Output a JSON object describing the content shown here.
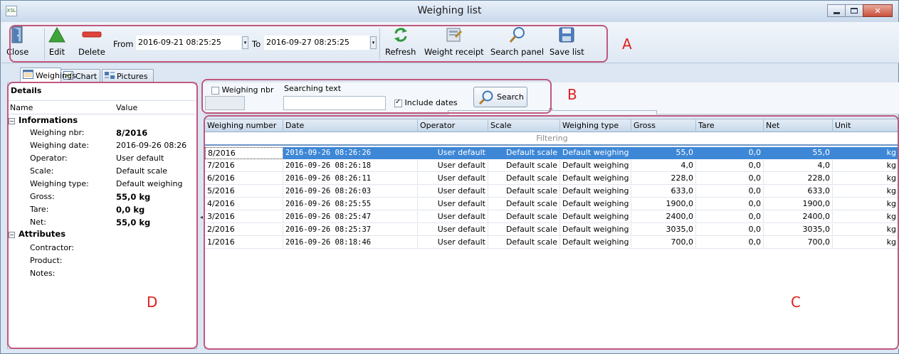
{
  "window": {
    "title": "Weighing list",
    "app_icon": "XSL"
  },
  "toolbar": {
    "close_label": "Close",
    "edit_label": "Edit",
    "delete_label": "Delete",
    "from_label": "From",
    "from_value": "2016-09-21 08:25:25",
    "to_label": "To",
    "to_value": "2016-09-27 08:25:25",
    "refresh_label": "Refresh",
    "weight_receipt_label": "Weight receipt",
    "search_panel_label": "Search panel",
    "save_list_label": "Save list"
  },
  "annotations": {
    "a": "A",
    "b": "B",
    "c": "C",
    "d": "D",
    "color": "#e02020",
    "box_color": "#c0587e"
  },
  "tabs": [
    {
      "label": "Weighings",
      "active": true
    },
    {
      "label": "Chart",
      "active": false
    },
    {
      "label": "Pictures",
      "active": false
    }
  ],
  "details": {
    "title": "Details",
    "col_name": "Name",
    "col_value": "Value",
    "group_info": "Informations",
    "group_attr": "Attributes",
    "rows": [
      {
        "name": "Weighing nbr:",
        "value": "8/2016"
      },
      {
        "name": "Weighing date:",
        "value": "2016-09-26 08:26"
      },
      {
        "name": "Operator:",
        "value": "User default"
      },
      {
        "name": "Scale:",
        "value": "Default scale"
      },
      {
        "name": "Weighing type:",
        "value": "Default weighing"
      },
      {
        "name": "Gross:",
        "value": "55,0 kg"
      },
      {
        "name": "Tare:",
        "value": "0,0 kg"
      },
      {
        "name": "Net:",
        "value": "55,0 kg"
      }
    ],
    "attributes": [
      {
        "name": "Contractor:",
        "value": ""
      },
      {
        "name": "Product:",
        "value": ""
      },
      {
        "name": "Notes:",
        "value": ""
      }
    ]
  },
  "search": {
    "weighing_nbr_label": "Weighing nbr",
    "weighing_nbr_checked": false,
    "searching_text_label": "Searching text",
    "searching_text_value": "",
    "include_dates_label": "Include dates",
    "include_dates_checked": true,
    "search_button_label": "Search"
  },
  "grid": {
    "columns": [
      "Weighing number",
      "Date",
      "Operator",
      "Scale",
      "Weighing type",
      "Gross",
      "Tare",
      "Net",
      "Unit"
    ],
    "filter_text": "Filtering",
    "selection_color": "#3d87d6",
    "rows": [
      [
        "8/2016",
        "2016-09-26 08:26:26",
        "User default",
        "Default scale",
        "Default weighing",
        "55,0",
        "0,0",
        "55,0",
        "kg"
      ],
      [
        "7/2016",
        "2016-09-26 08:26:18",
        "User default",
        "Default scale",
        "Default weighing",
        "4,0",
        "0,0",
        "4,0",
        "kg"
      ],
      [
        "6/2016",
        "2016-09-26 08:26:11",
        "User default",
        "Default scale",
        "Default weighing",
        "228,0",
        "0,0",
        "228,0",
        "kg"
      ],
      [
        "5/2016",
        "2016-09-26 08:26:03",
        "User default",
        "Default scale",
        "Default weighing",
        "633,0",
        "0,0",
        "633,0",
        "kg"
      ],
      [
        "4/2016",
        "2016-09-26 08:25:55",
        "User default",
        "Default scale",
        "Default weighing",
        "1900,0",
        "0,0",
        "1900,0",
        "kg"
      ],
      [
        "3/2016",
        "2016-09-26 08:25:47",
        "User default",
        "Default scale",
        "Default weighing",
        "2400,0",
        "0,0",
        "2400,0",
        "kg"
      ],
      [
        "2/2016",
        "2016-09-26 08:25:37",
        "User default",
        "Default scale",
        "Default weighing",
        "3035,0",
        "0,0",
        "3035,0",
        "kg"
      ],
      [
        "1/2016",
        "2016-09-26 08:18:46",
        "User default",
        "Default scale",
        "Default weighing",
        "700,0",
        "0,0",
        "700,0",
        "kg"
      ]
    ],
    "selected_row": 0
  }
}
